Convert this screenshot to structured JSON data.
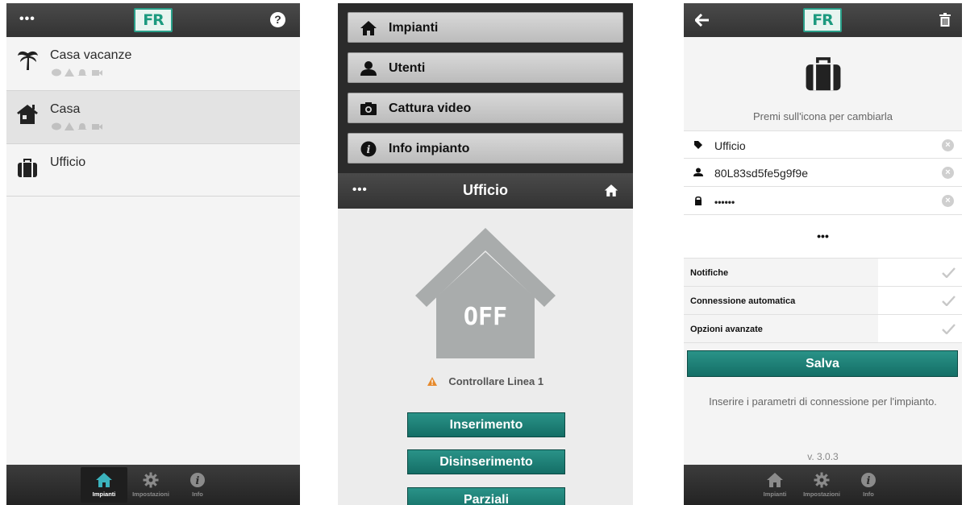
{
  "colors": {
    "accent": "#1c8a80",
    "header": "#3a3a3a",
    "warning": "#e6892b"
  },
  "screen1": {
    "header": {
      "menu_label": "•••",
      "logo_text": "FR",
      "help_label": "?"
    },
    "list": [
      {
        "name": "Casa vacanze",
        "icon": "palm-tree-icon",
        "status_icons": [
          "chat-icon",
          "warning-icon",
          "bell-icon",
          "camera-icon"
        ]
      },
      {
        "name": "Casa",
        "icon": "house-icon",
        "status_icons": [
          "chat-icon",
          "warning-icon",
          "bell-icon",
          "camera-icon"
        ]
      },
      {
        "name": "Ufficio",
        "icon": "briefcase-icon",
        "status_icons": []
      }
    ],
    "tabs": [
      {
        "label": "Impianti",
        "icon": "home-icon",
        "active": true
      },
      {
        "label": "Impostazioni",
        "icon": "gear-icon",
        "active": false
      },
      {
        "label": "Info",
        "icon": "info-icon",
        "active": false
      }
    ]
  },
  "screen2": {
    "menu": [
      {
        "label": "Impianti",
        "icon": "home-icon"
      },
      {
        "label": "Utenti",
        "icon": "user-icon"
      },
      {
        "label": "Cattura video",
        "icon": "camera-icon"
      },
      {
        "label": "Info impianto",
        "icon": "info-icon"
      }
    ],
    "panel": {
      "menu_label": "•••",
      "title": "Ufficio",
      "house_status": "OFF",
      "warning": "Controllare Linea 1",
      "buttons": [
        "Inserimento",
        "Disinserimento",
        "Parziali"
      ]
    }
  },
  "screen3": {
    "header": {
      "logo_text": "FR"
    },
    "icon_hint": "Premi sull'icona per cambiarla",
    "fields": [
      {
        "icon": "tag-icon",
        "value": "Ufficio"
      },
      {
        "icon": "user-icon",
        "value": "80L83sd5fe5g9f9e"
      },
      {
        "icon": "lock-icon",
        "value": "••••••"
      }
    ],
    "more_label": "•••",
    "options": [
      {
        "label": "Notifiche",
        "checked": false
      },
      {
        "label": "Connessione automatica",
        "checked": false
      },
      {
        "label": "Opzioni avanzate",
        "checked": false
      }
    ],
    "save_label": "Salva",
    "help_text": "Inserire i parametri di connessione per l'impianto.",
    "version": "v. 3.0.3",
    "tabs": [
      {
        "label": "Impianti",
        "icon": "home-icon"
      },
      {
        "label": "Impostazioni",
        "icon": "gear-icon"
      },
      {
        "label": "Info",
        "icon": "info-icon"
      }
    ]
  }
}
